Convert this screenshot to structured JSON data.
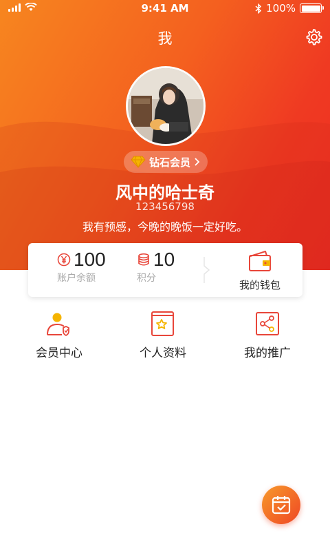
{
  "status_bar": {
    "time": "9:41 AM",
    "battery": "100%",
    "battery_level": 1.0,
    "icons": [
      "signal-icon",
      "wifi-icon",
      "bluetooth-icon",
      "battery-icon"
    ]
  },
  "header": {
    "title": "我",
    "settings_icon": "gear-icon"
  },
  "profile": {
    "vip_label": "钻石会员",
    "vip_icon": "diamond-icon",
    "name": "风中的哈士奇",
    "id": "123456798",
    "signature": "我有预感，今晚的晚饭一定好吃。"
  },
  "assets": {
    "balance": {
      "value": "100",
      "label": "账户余额",
      "icon": "yen-icon"
    },
    "points": {
      "value": "10",
      "label": "积分",
      "icon": "coins-icon"
    },
    "wallet": {
      "label": "我的钱包",
      "icon": "wallet-icon"
    }
  },
  "menu": [
    {
      "label": "会员中心",
      "icon": "member-icon"
    },
    {
      "label": "个人资料",
      "icon": "profile-book-icon"
    },
    {
      "label": "我的推广",
      "icon": "share-icon"
    }
  ],
  "fab": {
    "icon": "calendar-check-icon"
  },
  "colors": {
    "brand_orange": "#f7861f",
    "brand_red": "#ee2d24",
    "icon_red": "#e8463a",
    "icon_yellow": "#f5b400"
  }
}
